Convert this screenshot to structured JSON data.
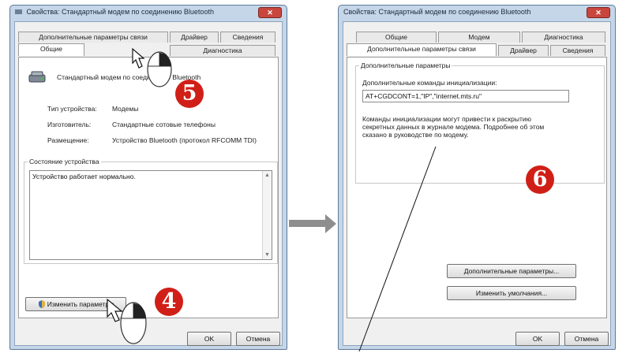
{
  "left_window": {
    "title": "Свойства: Стандартный модем по соединению Bluetooth",
    "close_label": "✕",
    "tabs_row_back": [
      "Дополнительные параметры связи",
      "Драйвер",
      "Сведения"
    ],
    "tabs_row_front": [
      "Общие",
      "Диагностика"
    ],
    "device_name": "Стандартный модем по соединению Bluetooth",
    "props": [
      {
        "label": "Тип устройства:",
        "value": "Модемы"
      },
      {
        "label": "Изготовитель:",
        "value": "Стандартные сотовые телефоны"
      },
      {
        "label": "Размещение:",
        "value": "Устройство Bluetooth (протокол RFCOMM TDI)"
      }
    ],
    "status_group_title": "Состояние устройства",
    "status_text": "Устройство работает нормально.",
    "change_button": "Изменить параметры",
    "ok_button": "OK",
    "cancel_button": "Отмена"
  },
  "right_window": {
    "title": "Свойства: Стандартный модем по соединению Bluetooth",
    "close_label": "✕",
    "tabs_row_back": [
      "Общие",
      "Модем",
      "Диагностика"
    ],
    "tabs_row_front": [
      "Дополнительные параметры связи",
      "Драйвер",
      "Сведения"
    ],
    "group_title": "Дополнительные параметры",
    "field_label": "Дополнительные команды инициализации:",
    "init_command": "AT+CGDCONT=1,\"IP\",\"internet.mts.ru\"",
    "note": "Команды инициализации могут привести к раскрытию секретных данных в журнале модема. Подробнее об этом сказано в руководстве по модему.",
    "advanced_button": "Дополнительные параметры...",
    "defaults_button": "Изменить умолчания...",
    "ok_button": "OK",
    "cancel_button": "Отмена"
  },
  "badges": [
    "4",
    "5",
    "6"
  ],
  "colors": {
    "badge": "#d01f17",
    "window_frame": "#c5d6e9",
    "arrow": "#8e8e8e"
  }
}
